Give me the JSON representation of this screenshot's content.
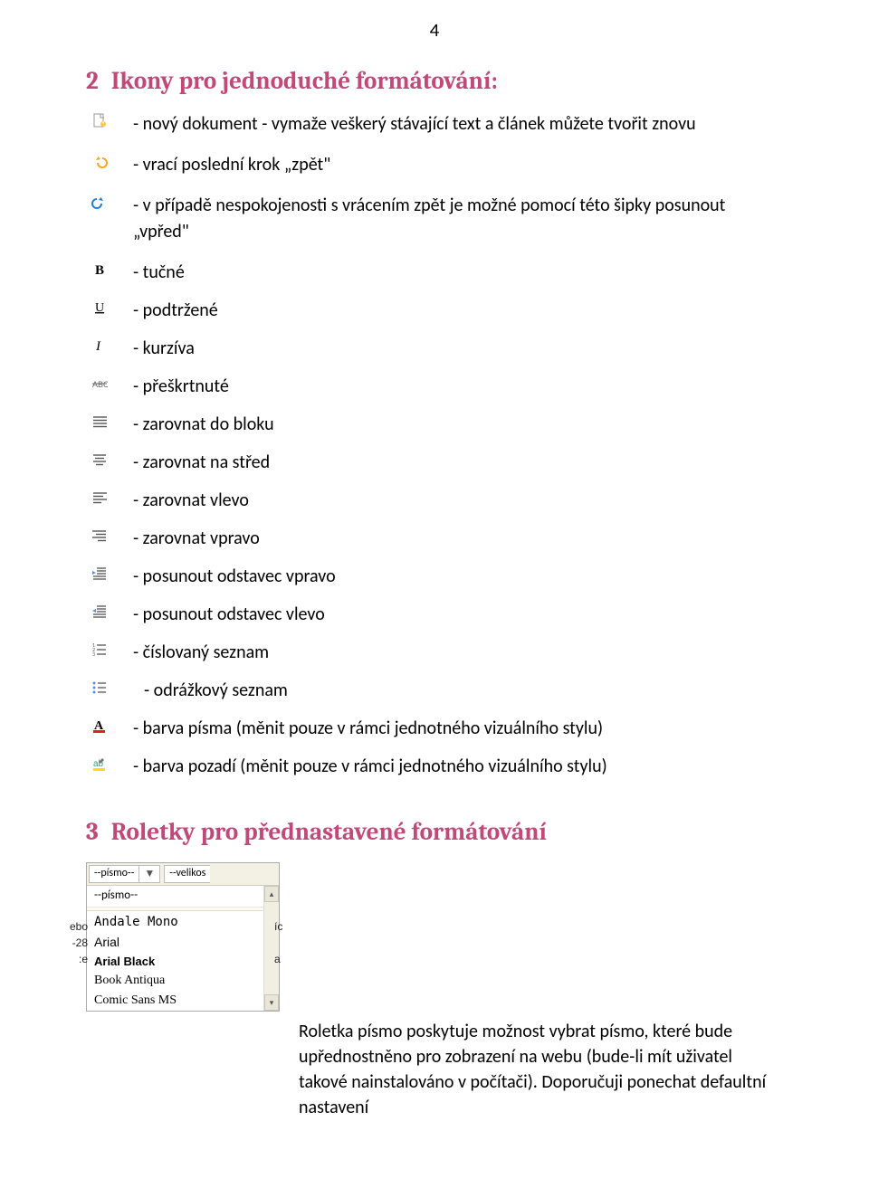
{
  "page_number": "4",
  "section2": {
    "num": "2",
    "title": "Ikony pro jednoduché formátování:",
    "items": [
      {
        "icon": "new-doc",
        "label": "- nový  dokument  - vymaže veškerý stávající text a článek můžete tvořit znovu"
      },
      {
        "icon": "undo",
        "label": "- vrací poslední krok „zpět\""
      },
      {
        "icon": "redo",
        "label": "- v případě nespokojenosti s vrácením zpět je možné pomocí této šipky posunout „vpřed\""
      },
      {
        "icon": "bold",
        "label": "- tučné"
      },
      {
        "icon": "underline",
        "label": "- podtržené"
      },
      {
        "icon": "italic",
        "label": "- kurzíva"
      },
      {
        "icon": "strike",
        "label": "- přeškrtnuté"
      },
      {
        "icon": "align-justify",
        "label": "- zarovnat do bloku"
      },
      {
        "icon": "align-center",
        "label": "- zarovnat na střed"
      },
      {
        "icon": "align-left",
        "label": "- zarovnat vlevo"
      },
      {
        "icon": "align-right",
        "label": "- zarovnat vpravo"
      },
      {
        "icon": "indent-right",
        "label": "- posunout odstavec vpravo"
      },
      {
        "icon": "indent-left",
        "label": "- posunout odstavec vlevo"
      },
      {
        "icon": "ordered-list",
        "label": "- číslovaný seznam"
      },
      {
        "icon": "bullet-list",
        "label": " - odrážkový seznam",
        "indent": true
      },
      {
        "icon": "font-color",
        "label": "- barva písma (měnit pouze v rámci jednotného vizuálního stylu)"
      },
      {
        "icon": "bg-color",
        "label": "- barva pozadí (měnit pouze v rámci jednotného vizuálního stylu)"
      }
    ]
  },
  "section3": {
    "num": "3",
    "title": "Roletky pro přednastavené formátování",
    "dropdown": {
      "combo1": "--písmo--",
      "combo2": "--velikos",
      "header": "--písmo--",
      "fonts": [
        {
          "class": "ff-andale",
          "label": "Andale Mono"
        },
        {
          "class": "ff-arial",
          "label": "Arial"
        },
        {
          "class": "ff-arialblack",
          "label": "Arial Black"
        },
        {
          "class": "ff-book",
          "label": "Book Antiqua"
        },
        {
          "class": "ff-comic",
          "label": "Comic Sans MS"
        }
      ],
      "cut_left": [
        "ebo",
        "-28",
        ":e"
      ],
      "cut_right": [
        "íc",
        "",
        "a"
      ]
    },
    "paragraph": "Roletka písmo poskytuje možnost vybrat písmo, které bude upřednostněno pro zobrazení na webu (bude-li mít uživatel takové nainstalováno v počítači). Doporučuji ponechat defaultní nastavení"
  }
}
